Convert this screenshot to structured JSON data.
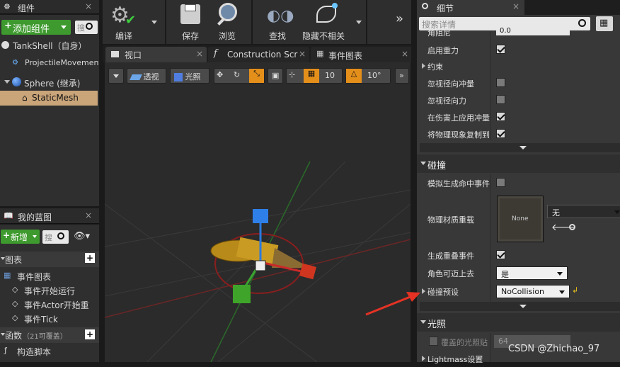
{
  "components_panel": {
    "title": "组件",
    "add_button": "添加组件",
    "search_placeholder": "搜",
    "items": [
      "TankShell（自身）",
      "ProjectileMovement",
      "Sphere (继承)",
      "StaticMesh"
    ]
  },
  "blueprint_panel": {
    "title": "我的蓝图",
    "add_button": "新增",
    "search_placeholder": "搜",
    "graphs_header": "图表",
    "event_graph": "事件图表",
    "events": [
      "事件开始运行",
      "事件Actor开始重",
      "事件Tick"
    ],
    "functions_header": "函数",
    "functions_count": "（21可覆盖）",
    "construction_script": "构造脚本"
  },
  "toolbar": {
    "compile": "编译",
    "save": "保存",
    "browse": "浏览",
    "find": "查找",
    "hide_unrelated": "隐藏不相关"
  },
  "tabs": [
    "视口",
    "Construction Scr",
    "事件图表"
  ],
  "viewport_toolbar": {
    "perspective": "透视",
    "lit": "光照",
    "grid_snap": "10",
    "angle_snap": "10°"
  },
  "details": {
    "title": "细节",
    "search_placeholder": "搜索详情",
    "mass_label": "角阻尼",
    "mass_value": "0.0",
    "physics_rows": [
      {
        "label": "启用重力",
        "checked": true
      },
      {
        "label": "约束",
        "expandable": true
      },
      {
        "label": "忽视径向冲量",
        "checked": false
      },
      {
        "label": "忽视径向力",
        "checked": false
      },
      {
        "label": "在伤害上应用冲量",
        "checked": true
      },
      {
        "label": "将物理现象复制到",
        "checked": true
      }
    ],
    "collision_header": "碰撞",
    "sim_hit_label": "模拟生成命中事件",
    "phys_mat_label": "物理材质重载",
    "phys_mat_thumb": "None",
    "phys_mat_value": "无",
    "overlap_label": "生成重叠事件",
    "can_step_label": "角色可迈上去",
    "can_step_value": "是",
    "preset_label": "碰撞预设",
    "preset_value": "NoCollision",
    "lighting_header": "光照",
    "lightmap_label": "覆盖的光照贴",
    "lightmap_value": "64",
    "lightmass_label": "Lightmass设置"
  },
  "watermark": "CSDN @Zhichao_97",
  "colors": {
    "accent_green": "#3e9a2e",
    "selection": "#caa57a",
    "panel": "#383838",
    "header": "#2b2b2b",
    "arrow": "#e53224"
  }
}
